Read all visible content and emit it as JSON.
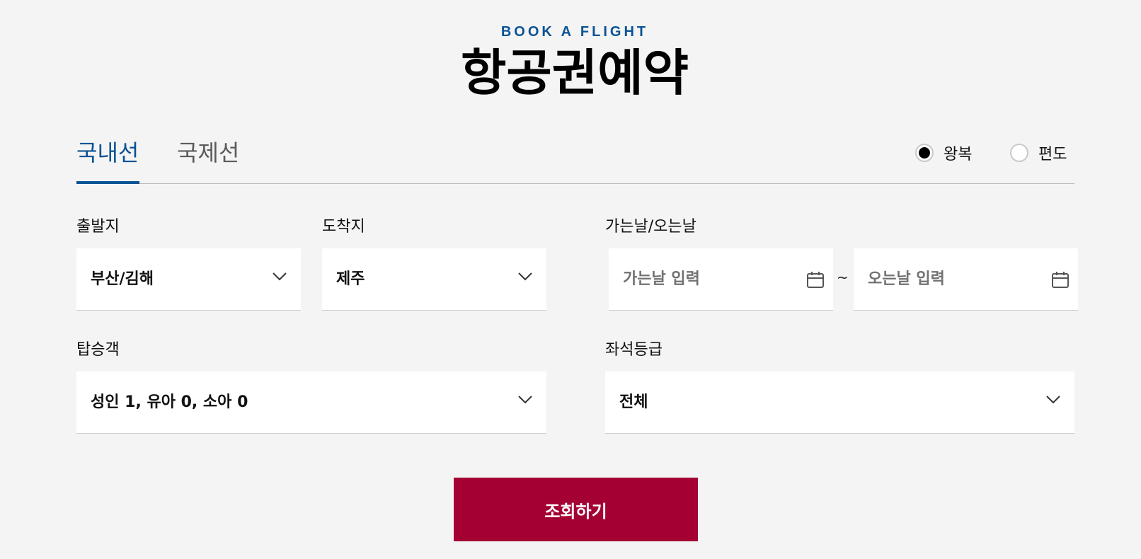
{
  "header": {
    "eyebrow": "BOOK A FLIGHT",
    "title": "항공권예약"
  },
  "tabs": [
    {
      "label": "국내선",
      "active": true
    },
    {
      "label": "국제선",
      "active": false
    }
  ],
  "trip_type": {
    "options": [
      {
        "label": "왕복",
        "selected": true
      },
      {
        "label": "편도",
        "selected": false
      }
    ]
  },
  "form": {
    "departure": {
      "label": "출발지",
      "value": "부산/김해"
    },
    "arrival": {
      "label": "도착지",
      "value": "제주"
    },
    "dates": {
      "label": "가는날/오는날",
      "departure_placeholder": "가는날 입력",
      "return_placeholder": "오는날 입력",
      "separator": "~"
    },
    "passengers": {
      "label": "탑승객",
      "value": "성인 1, 유아 0, 소아 0"
    },
    "seat_class": {
      "label": "좌석등급",
      "value": "전체"
    }
  },
  "search_button": {
    "label": "조회하기"
  },
  "colors": {
    "accent_blue": "#0b5394",
    "button_red": "#a50034",
    "background": "#f4f4f4"
  },
  "icons": [
    "chevron-down-icon",
    "calendar-icon"
  ]
}
